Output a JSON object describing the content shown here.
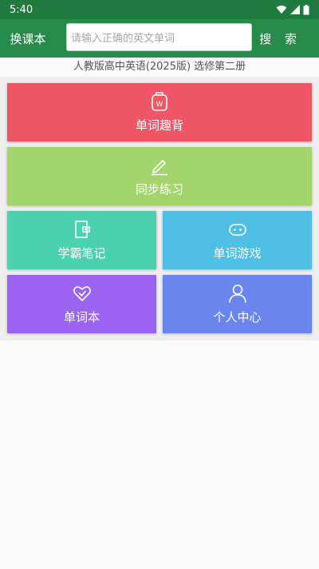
{
  "status": {
    "time": "5:40"
  },
  "appbar": {
    "switch_label": "换课本",
    "search_placeholder": "请输入正确的英文单词",
    "search_label": "搜 索"
  },
  "book_title": "人教版高中英语(2025版) 选修第二册",
  "tiles": [
    {
      "label": "单词趣背",
      "icon": "word-badge-icon",
      "color": "#ef5766"
    },
    {
      "label": "同步练习",
      "icon": "pencil-icon",
      "color": "#a4d56c"
    },
    {
      "label": "学霸笔记",
      "icon": "notebook-icon",
      "color": "#4cd1ad"
    },
    {
      "label": "单词游戏",
      "icon": "gamepad-icon",
      "color": "#4fbfe5"
    },
    {
      "label": "单词本",
      "icon": "heart-check-icon",
      "color": "#9b64f0"
    },
    {
      "label": "个人中心",
      "icon": "person-icon",
      "color": "#6a85ee"
    }
  ]
}
